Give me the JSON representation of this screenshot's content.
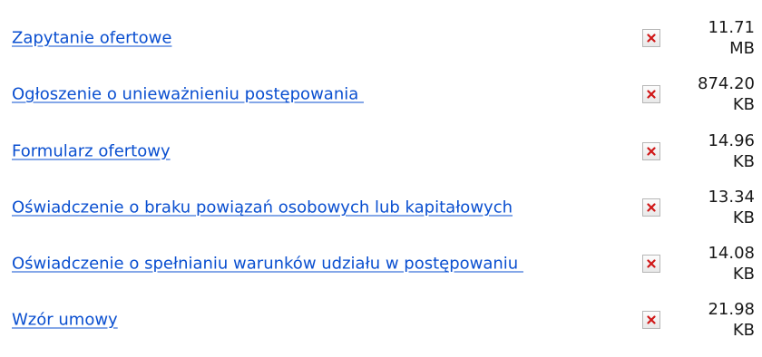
{
  "files": [
    {
      "name": "Zapytanie ofertowe",
      "icon": "broken-image-icon",
      "size_value": "11.71",
      "size_unit": "MB"
    },
    {
      "name": "Ogłoszenie o unieważnieniu postępowania ",
      "icon": "broken-image-icon",
      "size_value": "874.20",
      "size_unit": "KB"
    },
    {
      "name": "Formularz ofertowy",
      "icon": "broken-image-icon",
      "size_value": "14.96",
      "size_unit": "KB"
    },
    {
      "name": "Oświadczenie o braku powiązań osobowych lub kapitałowych",
      "icon": "broken-image-icon",
      "size_value": "13.34",
      "size_unit": "KB"
    },
    {
      "name": "Oświadczenie o spełnianiu warunków udziału w postępowaniu ",
      "icon": "broken-image-icon",
      "size_value": "14.08",
      "size_unit": "KB"
    },
    {
      "name": "Wzór umowy",
      "icon": "broken-image-icon",
      "size_value": "21.98",
      "size_unit": "KB"
    }
  ],
  "colors": {
    "link": "#0a4fd0",
    "icon_cross": "#d01818"
  }
}
